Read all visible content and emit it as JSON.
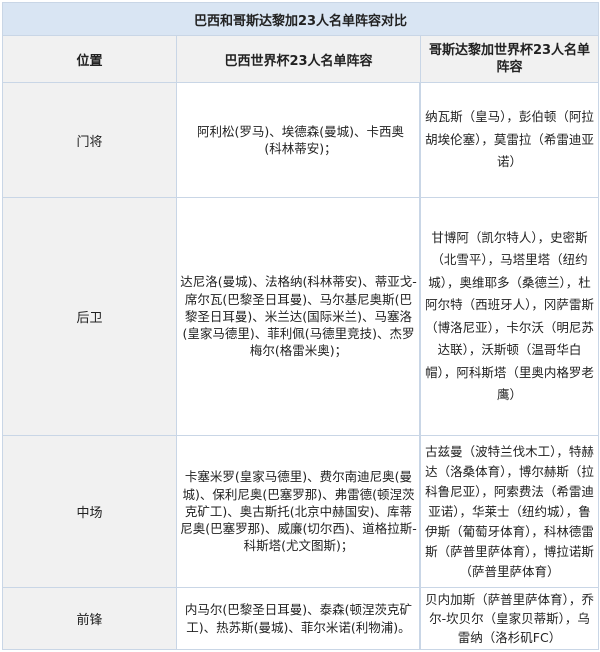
{
  "title": "巴西和哥斯达黎加23人名单阵容对比",
  "headers": {
    "position": "位置",
    "brazil": "巴西世界杯23人名单阵容",
    "costa_rica": "哥斯达黎加世界杯23人名单阵容"
  },
  "rows": [
    {
      "position": "门将",
      "brazil": "阿利松(罗马)、埃德森(曼城)、卡西奥(科林蒂安)；",
      "costa_rica": "纳瓦斯（皇马），彭伯顿（阿拉胡埃伦塞），莫雷拉（希雷迪亚诺）"
    },
    {
      "position": "后卫",
      "brazil": "达尼洛(曼城)、法格纳(科林蒂安)、蒂亚戈-席尔瓦(巴黎圣日耳曼)、马尔基尼奥斯(巴黎圣日耳曼)、米兰达(国际米兰)、马塞洛(皇家马德里)、菲利佩(马德里竞技)、杰罗梅尔(格雷米奥)；",
      "costa_rica": "甘博阿（凯尔特人），史密斯（北雪平），马塔里塔（纽约城），奥维耶多（桑德兰），杜阿尔特（西班牙人），冈萨雷斯（博洛尼亚），卡尔沃（明尼苏达联），沃斯顿（温哥华白帽），阿科斯塔（里奥内格罗老鹰）"
    },
    {
      "position": "中场",
      "brazil": "卡塞米罗(皇家马德里)、费尔南迪尼奥(曼城)、保利尼奥(巴塞罗那)、弗雷德(顿涅茨克矿工)、奥古斯托(北京中赫国安)、库蒂尼奥(巴塞罗那)、威廉(切尔西)、道格拉斯-科斯塔(尤文图斯)；",
      "costa_rica": "古兹曼（波特兰伐木工），特赫达（洛桑体育），博尔赫斯（拉科鲁尼亚），阿索费法（希雷迪亚诺），华莱士（纽约城），鲁伊斯（葡萄牙体育），科林德雷斯（萨普里萨体育），博拉诺斯（萨普里萨体育）"
    },
    {
      "position": "前锋",
      "brazil": "内马尔(巴黎圣日耳曼)、泰森(顿涅茨克矿工)、热苏斯(曼城)、菲尔米诺(利物浦)。",
      "costa_rica": "贝内加斯（萨普里萨体育），乔尔-坎贝尔（皇家贝蒂斯），乌雷纳（洛杉矶FC）"
    }
  ]
}
